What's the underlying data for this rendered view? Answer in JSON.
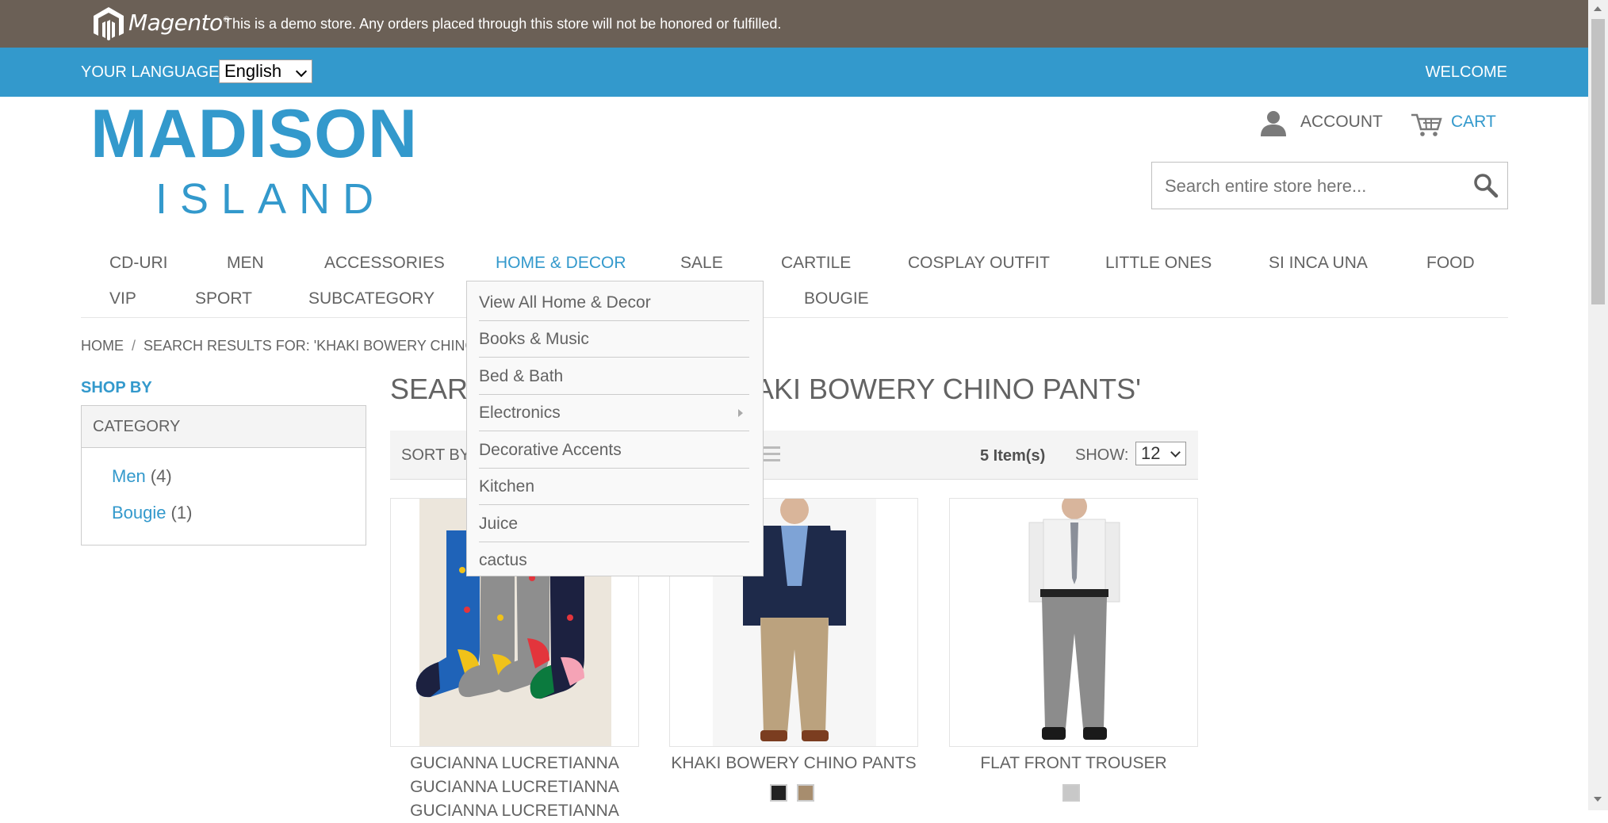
{
  "demo_notice": {
    "brand": "Magento",
    "message": "This is a demo store. Any orders placed through this store will not be honored or fulfilled."
  },
  "language_bar": {
    "label": "YOUR LANGUAGE:",
    "selected_language": "English",
    "welcome": "WELCOME"
  },
  "logo": {
    "line1": "MADISON",
    "line2": "ISLAND"
  },
  "header_links": {
    "account": "ACCOUNT",
    "cart": "CART"
  },
  "search": {
    "placeholder": "Search entire store here..."
  },
  "nav": {
    "row1": [
      "CD-URI",
      "MEN",
      "ACCESSORIES",
      "HOME & DECOR",
      "SALE",
      "CARTILE",
      "COSPLAY OUTFIT",
      "LITTLE ONES",
      "SI INCA UNA",
      "FOOD"
    ],
    "row2": [
      "VIP",
      "SPORT",
      "SUBCATEGORY",
      "BOUGIE"
    ],
    "active": "HOME & DECOR"
  },
  "dropdown": {
    "items": [
      "View All Home & Decor",
      "Books & Music",
      "Bed & Bath",
      "Electronics",
      "Decorative Accents",
      "Kitchen",
      "Juice",
      "cactus"
    ]
  },
  "breadcrumb": {
    "home": "HOME",
    "separator": "/",
    "current": "SEARCH RESULTS FOR: 'KHAKI BOWERY CHINO"
  },
  "sidebar": {
    "title": "SHOP BY",
    "category_heading": "CATEGORY",
    "categories": [
      {
        "label": "Men",
        "count": "(4)"
      },
      {
        "label": "Bougie",
        "count": "(1)"
      }
    ]
  },
  "main": {
    "title_left": "SEAR",
    "title_right": "AKI BOWERY CHINO PANTS'",
    "toolbar": {
      "sort_label": "SORT BY",
      "item_count": "5 Item(s)",
      "show_label": "SHOW:",
      "show_value": "12"
    },
    "products": [
      {
        "name_lines": [
          "GUCIANNA LUCRETIANNA",
          "GUCIANNA LUCRETIANNA",
          "GUCIANNA LUCRETIANNA"
        ],
        "swatches": []
      },
      {
        "name_lines": [
          "KHAKI BOWERY CHINO PANTS"
        ],
        "swatches": [
          "#222222",
          "#a78d6e"
        ]
      },
      {
        "name_lines": [
          "FLAT FRONT TROUSER"
        ],
        "swatches": [
          "#c8c8c8"
        ]
      }
    ]
  },
  "colors": {
    "demo_bar": "#6b6056",
    "accent": "#3399cc",
    "text": "#636363"
  }
}
